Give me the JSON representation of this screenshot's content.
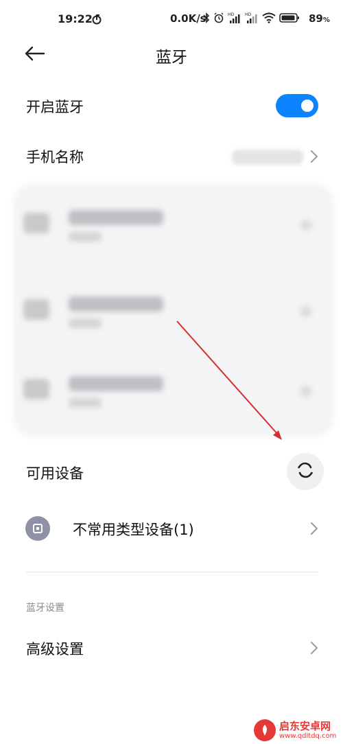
{
  "status_bar": {
    "time": "19:22",
    "net_speed": "0.0K/s",
    "battery": "89",
    "battery_unit": "%",
    "icons": [
      "bluetooth-icon",
      "alarm-icon",
      "hd-signal-icon",
      "hd-signal-icon",
      "wifi-icon",
      "battery-icon"
    ]
  },
  "header": {
    "title": "蓝牙"
  },
  "settings": {
    "bluetooth_toggle_label": "开启蓝牙",
    "bluetooth_enabled": true,
    "phone_name_label": "手机名称"
  },
  "available": {
    "title": "可用设备",
    "uncommon_label": "不常用类型设备(1)"
  },
  "bt_settings": {
    "group_title": "蓝牙设置",
    "advanced_label": "高级设置"
  },
  "watermark": {
    "name": "启东安卓网",
    "url": "www.qdltdq.com"
  },
  "colors": {
    "accent": "#0d84ff",
    "annotation_arrow": "#d32f2f",
    "watermark": "#e53935"
  }
}
